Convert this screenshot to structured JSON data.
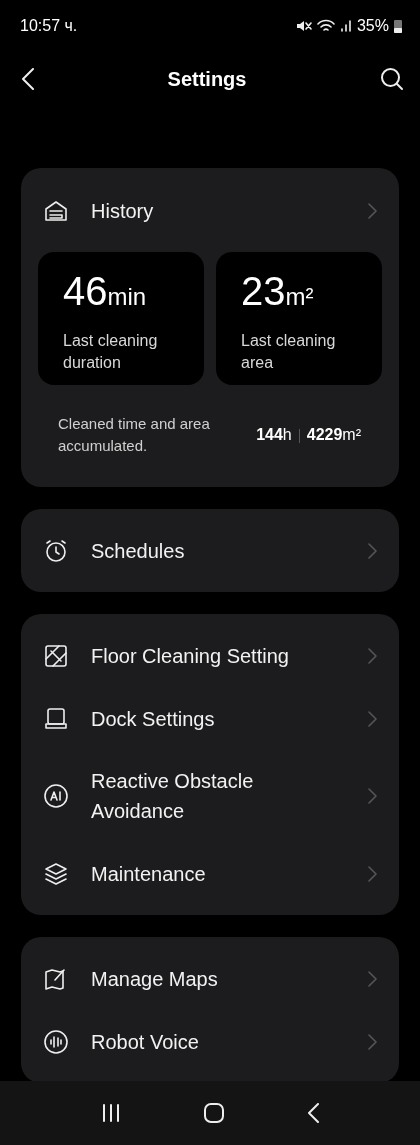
{
  "status_bar": {
    "time": "10:57 ч.",
    "battery": "35%"
  },
  "header": {
    "title": "Settings"
  },
  "history": {
    "title": "History",
    "stats": [
      {
        "value": "46",
        "unit": "min",
        "label": "Last cleaning duration"
      },
      {
        "value": "23",
        "unit": "m²",
        "label": "Last cleaning area"
      }
    ],
    "accumulated": {
      "text": "Cleaned time and area accumulated.",
      "hours": "144",
      "hours_unit": "h",
      "area": "4229",
      "area_unit": "m²"
    }
  },
  "groups": [
    {
      "items": [
        {
          "kind": "alarm",
          "label": "Schedules"
        }
      ]
    },
    {
      "items": [
        {
          "kind": "floor",
          "label": "Floor Cleaning Setting"
        },
        {
          "kind": "dock",
          "label": "Dock Settings"
        },
        {
          "kind": "ai",
          "label": "Reactive Obstacle Avoidance"
        },
        {
          "kind": "layers",
          "label": "Maintenance"
        }
      ]
    },
    {
      "items": [
        {
          "kind": "map",
          "label": "Manage Maps"
        },
        {
          "kind": "voice",
          "label": "Robot Voice"
        }
      ]
    }
  ]
}
